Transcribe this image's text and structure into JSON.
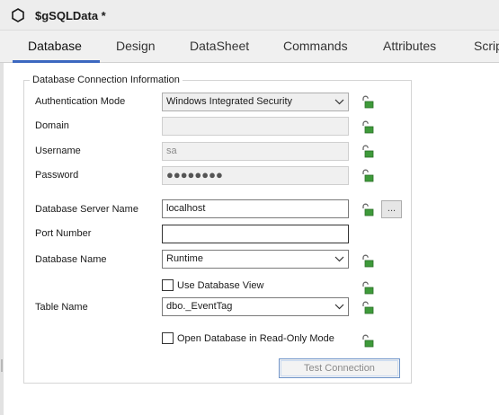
{
  "window": {
    "title": "$gSQLData *"
  },
  "tabs": [
    {
      "label": "Database"
    },
    {
      "label": "Design"
    },
    {
      "label": "DataSheet"
    },
    {
      "label": "Commands"
    },
    {
      "label": "Attributes"
    },
    {
      "label": "Scrip"
    }
  ],
  "active_tab": "Database",
  "group": {
    "legend": "Database Connection Information"
  },
  "fields": {
    "auth_mode": {
      "label": "Authentication Mode",
      "value": "Windows Integrated Security"
    },
    "domain": {
      "label": "Domain",
      "value": ""
    },
    "username": {
      "label": "Username",
      "value": "sa"
    },
    "password": {
      "label": "Password",
      "value": "●●●●●●●●"
    },
    "server": {
      "label": "Database Server Name",
      "value": "localhost"
    },
    "port": {
      "label": "Port Number",
      "value": ""
    },
    "db_name": {
      "label": "Database Name",
      "value": "Runtime"
    },
    "table_name": {
      "label": "Table Name",
      "value": "dbo._EventTag"
    }
  },
  "checkboxes": {
    "use_view": {
      "label": "Use Database View",
      "checked": false
    },
    "read_only": {
      "label": "Open Database in Read-Only Mode",
      "checked": false
    }
  },
  "buttons": {
    "browse": "...",
    "test_connection": "Test Connection"
  },
  "colors": {
    "tab_accent": "#3c68c0",
    "lock_green": "#3e9a3a"
  }
}
